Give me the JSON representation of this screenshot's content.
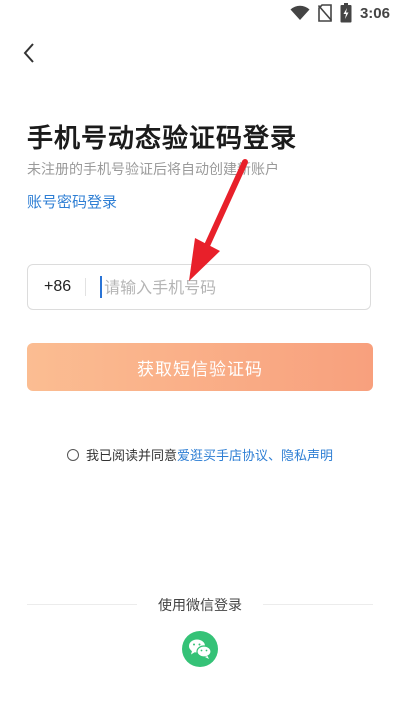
{
  "status_bar": {
    "time": "3:06",
    "icons": [
      "wifi-icon",
      "no-sim-icon",
      "battery-icon"
    ]
  },
  "nav": {
    "back_icon": "chevron-left-icon"
  },
  "login": {
    "title": "手机号动态验证码登录",
    "subtitle": "未注册的手机号验证后将自动创建新账户",
    "alt_login_link": "账号密码登录",
    "country_code": "+86",
    "phone_placeholder": "请输入手机号码",
    "phone_value": "",
    "sms_button": "获取短信验证码"
  },
  "agreement": {
    "prefix": "我已阅读并同意",
    "link_text": "爱逛买手店协议、隐私声明",
    "checked": false
  },
  "wechat": {
    "label": "使用微信登录",
    "icon": "wechat-icon"
  },
  "colors": {
    "link": "#2f7fd4",
    "button_gradient_start": "#fbbd92",
    "button_gradient_end": "#f8a07d",
    "wechat_green": "#35c277",
    "annotation_arrow": "#e8202a"
  }
}
